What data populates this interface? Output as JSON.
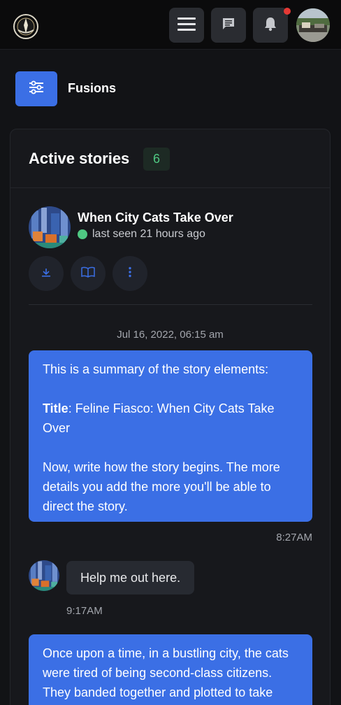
{
  "header": {
    "logo_icon": "emblem-logo",
    "menu_icon": "hamburger-menu-icon",
    "chat_icon": "chat-bubble-icon",
    "bell_icon": "bell-icon",
    "has_notification": true
  },
  "toolbar": {
    "fusions_label": "Fusions"
  },
  "panel": {
    "title": "Active stories",
    "count": "6"
  },
  "story": {
    "title": "When City Cats Take Over",
    "status": "last seen 21 hours ago",
    "actions": [
      "download-icon",
      "book-icon",
      "more-vertical-icon"
    ]
  },
  "messages": {
    "date": "Jul 16, 2022, 06:15 am",
    "m1": {
      "intro": "This is a summary of the story elements:",
      "title_label": "Title",
      "title_value": ": Feline Fiasco: When City Cats Take Over",
      "instruction": "Now, write how the story begins. The more details you add the more you'll be able to direct the story.",
      "time": "8:27AM"
    },
    "m2": {
      "text": "Help me out here.",
      "time": "9:17AM"
    },
    "m3": {
      "text": "Once upon a time, in a bustling city, the cats were tired of being second-class citizens. They banded together and plotted to take over the city, but they"
    }
  },
  "colors": {
    "accent": "#3b6fe5",
    "online": "#4fc882",
    "notification": "#e53935",
    "background": "#121316"
  }
}
